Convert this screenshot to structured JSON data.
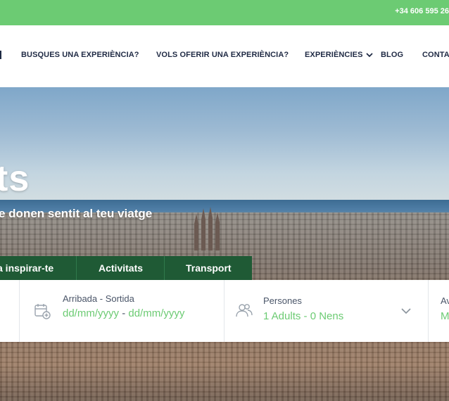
{
  "topbar": {
    "phone": "+34 606 595 26"
  },
  "nav": {
    "items": [
      {
        "label": "BUSQUES UNA EXPERIÈNCIA?"
      },
      {
        "label": "VOLS OFERIR UNA EXPERIÈNCIA?"
      },
      {
        "label": "EXPERIÈNCIES"
      },
      {
        "label": "BLOG"
      },
      {
        "label": "CONTA"
      }
    ]
  },
  "hero": {
    "title": "ts",
    "subtitle": "e donen sentit al teu viatge"
  },
  "tabs": [
    {
      "label": "a inspirar-te"
    },
    {
      "label": "Activitats"
    },
    {
      "label": "Transport"
    }
  ],
  "search": {
    "dates": {
      "label": "Arribada - Sortida",
      "from": "dd/mm/yyyy",
      "separator": "-",
      "to": "dd/mm/yyyy"
    },
    "people": {
      "label": "Persones",
      "value": "1 Adults - 0 Nens"
    },
    "next": {
      "label": "Av",
      "value": "M"
    }
  },
  "colors": {
    "green": "#6ccb73",
    "dark_green": "#1f5a35",
    "navy": "#1f2a44"
  },
  "icons": [
    "calendar-plus-icon",
    "people-icon",
    "chevron-down-icon"
  ]
}
